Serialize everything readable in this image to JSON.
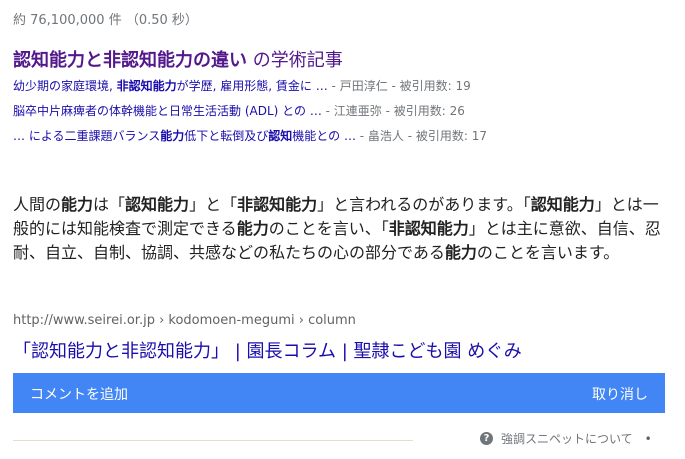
{
  "result_stats": "約 76,100,000 件 （0.50 秒）",
  "scholar": {
    "title_bold": "認知能力と非認知能力の違い",
    "title_suffix": " の学術記事",
    "papers": [
      {
        "pre": "幼少期の家庭環境, ",
        "bold": "非認知能力",
        "post": "が学歴, 雇用形態, 賃金に …",
        "meta": " - 戸田淳仁 - 被引用数: 19"
      },
      {
        "pre": "脳卒中片麻痺者の体幹機能と日常生活活動 (ADL) との …",
        "bold": "",
        "post": "",
        "meta": " - 江連亜弥 - 被引用数: 26"
      },
      {
        "pre": "… による二重課題バランス",
        "bold": "能力",
        "post": "低下と転倒及び",
        "bold2": "認知",
        "post2": "機能との …",
        "meta": " - 畠浩人 - 被引用数: 17"
      }
    ]
  },
  "snippet": {
    "s1": "人間の",
    "b1": "能力",
    "s2": "は「",
    "b2": "認知能力",
    "s3": "」と「",
    "b3": "非認知能力",
    "s4": "」と言われるのがあります。「",
    "b4": "認知能力",
    "s5": "」とは一般的には知能検査で測定できる",
    "b5": "能力",
    "s6": "のことを言い、「",
    "b6": "非認知能力",
    "s7": "」とは主に意欲、自信、忍耐、自立、自制、協調、共感などの私たちの心の部分である",
    "b7": "能力",
    "s8": "のことを言います。"
  },
  "result": {
    "cite": "http://www.seirei.or.jp › kodomoen-megumi › column",
    "title": "「認知能力と非認知能力」 | 園長コラム | 聖隷こども園 めぐみ"
  },
  "comment_bar": {
    "add_label": "コメントを追加",
    "cancel_label": "取り消し"
  },
  "footer": {
    "icon": "question-icon",
    "label": "強調スニペットについて",
    "dot": "•"
  },
  "colors": {
    "link": "#1a0dab",
    "visited": "#52188c",
    "comment_bar": "#4285f4"
  }
}
